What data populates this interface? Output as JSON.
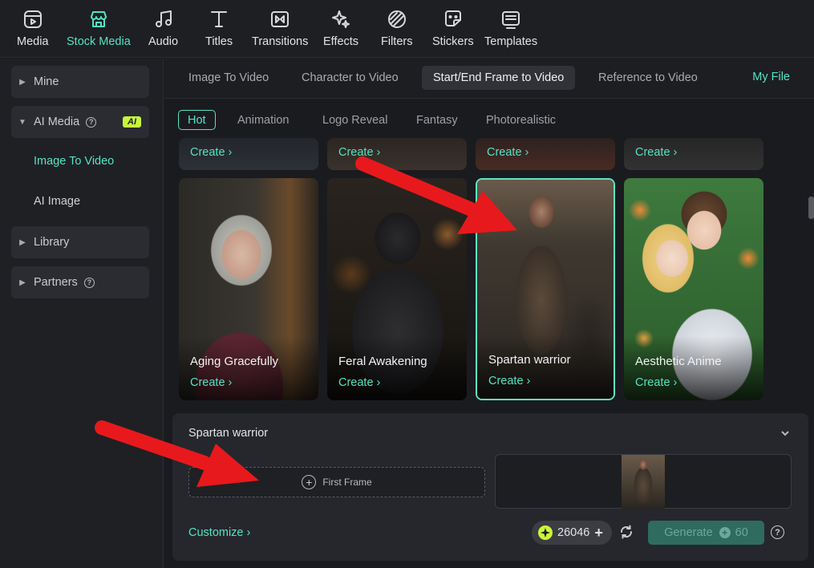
{
  "toolbar": {
    "items": [
      {
        "label": "Media",
        "icon": "media-icon"
      },
      {
        "label": "Stock Media",
        "icon": "stock-media-icon"
      },
      {
        "label": "Audio",
        "icon": "music-note-icon"
      },
      {
        "label": "Titles",
        "icon": "text-t-icon"
      },
      {
        "label": "Transitions",
        "icon": "transitions-icon"
      },
      {
        "label": "Effects",
        "icon": "effects-sparkle-icon"
      },
      {
        "label": "Filters",
        "icon": "filters-icon"
      },
      {
        "label": "Stickers",
        "icon": "sticker-icon"
      },
      {
        "label": "Templates",
        "icon": "templates-icon"
      }
    ],
    "active": "Stock Media"
  },
  "sidebar": {
    "mine": "Mine",
    "ai_media": "AI Media",
    "ai_badge": "AI",
    "image_to_video": "Image To Video",
    "ai_image": "AI Image",
    "library": "Library",
    "partners": "Partners"
  },
  "tabs": {
    "items": [
      "Image To Video",
      "Character to Video",
      "Start/End Frame to Video",
      "Reference to Video"
    ],
    "active": "Start/End Frame to Video",
    "my_file": "My File"
  },
  "filters": {
    "items": [
      "Hot",
      "Animation",
      "Logo Reveal",
      "Fantasy",
      "Photorealistic"
    ],
    "active": "Hot"
  },
  "create_label": "Create",
  "cards": [
    {
      "title": "Aging Gracefully"
    },
    {
      "title": "Feral Awakening"
    },
    {
      "title": "Spartan warrior",
      "selected": true
    },
    {
      "title": "Aesthetic Anime"
    }
  ],
  "panel": {
    "title": "Spartan warrior",
    "first_frame": "First Frame",
    "customize": "Customize",
    "credits": "26046",
    "generate": "Generate",
    "generate_cost": "60"
  },
  "colors": {
    "accent": "#54e3c3",
    "ai_badge": "#c8f53a",
    "annotation_arrow": "#e8191c"
  }
}
